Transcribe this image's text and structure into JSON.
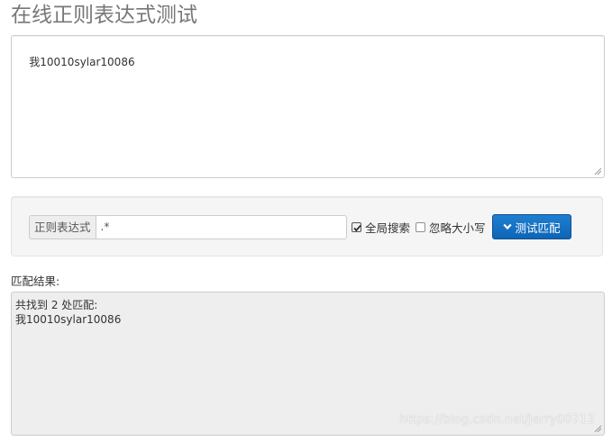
{
  "page": {
    "title": "在线正则表达式测试"
  },
  "source": {
    "text": "我10010sylar10086"
  },
  "toolbar": {
    "regex_addon_label": "正则表达式",
    "regex_value": ".*",
    "global_search_label": "全局搜索",
    "global_search_checked": true,
    "ignore_case_label": "忽略大小写",
    "ignore_case_checked": false,
    "test_button_label": "测试匹配",
    "test_button_icon": "chevron-down-icon",
    "accent_color": "#1272c4"
  },
  "result": {
    "label": "匹配结果:",
    "summary": "共找到 2 处匹配:",
    "match_line": "我10010sylar10086"
  },
  "watermark": {
    "text": "https://blog.csdn.net/Jerry00713"
  }
}
